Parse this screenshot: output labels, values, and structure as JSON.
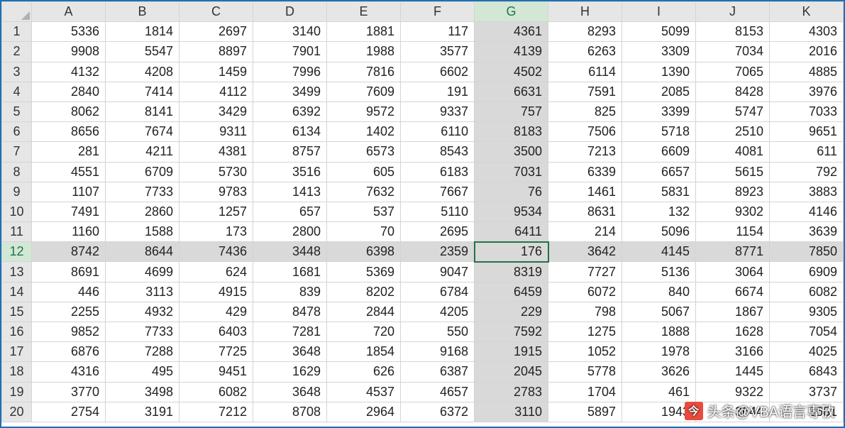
{
  "active_cell": {
    "row": 12,
    "col": "G"
  },
  "columns": [
    "A",
    "B",
    "C",
    "D",
    "E",
    "F",
    "G",
    "H",
    "I",
    "J",
    "K"
  ],
  "row_headers": [
    "1",
    "2",
    "3",
    "4",
    "5",
    "6",
    "7",
    "8",
    "9",
    "10",
    "11",
    "12",
    "13",
    "14",
    "15",
    "16",
    "17",
    "18",
    "19",
    "20"
  ],
  "watermark": {
    "prefix": "头条",
    "handle": "@VBA语言専攷"
  },
  "chart_data": {
    "type": "table",
    "columns": [
      "A",
      "B",
      "C",
      "D",
      "E",
      "F",
      "G",
      "H",
      "I",
      "J",
      "K"
    ],
    "rows": [
      [
        5336,
        1814,
        2697,
        3140,
        1881,
        117,
        4361,
        8293,
        5099,
        8153,
        4303
      ],
      [
        9908,
        5547,
        8897,
        7901,
        1988,
        3577,
        4139,
        6263,
        3309,
        7034,
        2016
      ],
      [
        4132,
        4208,
        1459,
        7996,
        7816,
        6602,
        4502,
        6114,
        1390,
        7065,
        4885
      ],
      [
        2840,
        7414,
        4112,
        3499,
        7609,
        191,
        6631,
        7591,
        2085,
        8428,
        3976
      ],
      [
        8062,
        8141,
        3429,
        6392,
        9572,
        9337,
        757,
        825,
        3399,
        5747,
        7033
      ],
      [
        8656,
        7674,
        9311,
        6134,
        1402,
        6110,
        8183,
        7506,
        5718,
        2510,
        9651
      ],
      [
        281,
        4211,
        4381,
        8757,
        6573,
        8543,
        3500,
        7213,
        6609,
        4081,
        611
      ],
      [
        4551,
        6709,
        5730,
        3516,
        605,
        6183,
        7031,
        6339,
        6657,
        5615,
        792
      ],
      [
        1107,
        7733,
        9783,
        1413,
        7632,
        7667,
        76,
        1461,
        5831,
        8923,
        3883
      ],
      [
        7491,
        2860,
        1257,
        657,
        537,
        5110,
        9534,
        8631,
        132,
        9302,
        4146
      ],
      [
        1160,
        1588,
        173,
        2800,
        70,
        2695,
        6411,
        214,
        5096,
        1154,
        3639
      ],
      [
        8742,
        8644,
        7436,
        3448,
        6398,
        2359,
        176,
        3642,
        4145,
        8771,
        7850
      ],
      [
        8691,
        4699,
        624,
        1681,
        5369,
        9047,
        8319,
        7727,
        5136,
        3064,
        6909
      ],
      [
        446,
        3113,
        4915,
        839,
        8202,
        6784,
        6459,
        6072,
        840,
        6674,
        6082
      ],
      [
        2255,
        4932,
        429,
        8478,
        2844,
        4205,
        229,
        798,
        5067,
        1867,
        9305
      ],
      [
        9852,
        7733,
        6403,
        7281,
        720,
        550,
        7592,
        1275,
        1888,
        1628,
        7054
      ],
      [
        6876,
        7288,
        7725,
        3648,
        1854,
        9168,
        1915,
        1052,
        1978,
        3166,
        4025
      ],
      [
        4316,
        495,
        9451,
        1629,
        626,
        6387,
        2045,
        5778,
        3626,
        1445,
        6843
      ],
      [
        3770,
        3498,
        6082,
        3648,
        4537,
        4657,
        2783,
        1704,
        461,
        9322,
        3737
      ],
      [
        2754,
        3191,
        7212,
        8708,
        2964,
        6372,
        3110,
        5897,
        1943,
        3644,
        3681
      ]
    ]
  }
}
